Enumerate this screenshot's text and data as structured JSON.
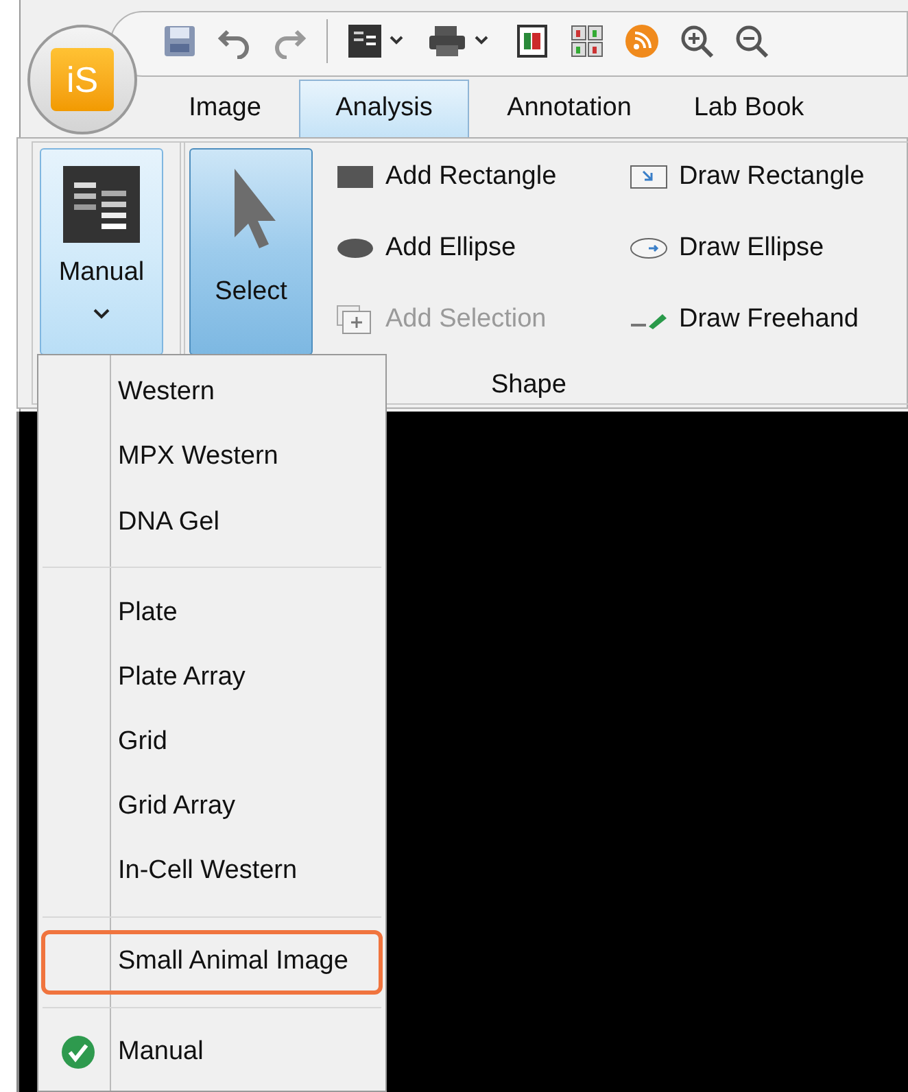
{
  "app_button": {
    "label": "iS"
  },
  "tabs": [
    {
      "label": "Image",
      "selected": false
    },
    {
      "label": "Analysis",
      "selected": true
    },
    {
      "label": "Annotation",
      "selected": false
    },
    {
      "label": "Lab Book",
      "selected": false
    }
  ],
  "ribbon": {
    "large_buttons": [
      {
        "label": "Manual",
        "expanded": true,
        "pressed": false,
        "dropdown": true
      },
      {
        "label": "Select",
        "expanded": false,
        "pressed": true,
        "dropdown": false
      }
    ],
    "shape_tools": [
      {
        "kind": "rect",
        "label": "Add Rectangle",
        "disabled": false
      },
      {
        "kind": "draw-rect",
        "label": "Draw Rectangle",
        "disabled": false
      },
      {
        "kind": "ellipse",
        "label": "Add Ellipse",
        "disabled": false
      },
      {
        "kind": "draw-ellipse",
        "label": "Draw Ellipse",
        "disabled": false
      },
      {
        "kind": "selection",
        "label": "Add Selection",
        "disabled": true
      },
      {
        "kind": "freehand",
        "label": "Draw Freehand",
        "disabled": false
      }
    ],
    "group_label": "Shape"
  },
  "menu": {
    "groups": [
      {
        "items": [
          {
            "label": "Western",
            "checked": false,
            "outlined": false
          },
          {
            "label": "MPX Western",
            "checked": false,
            "outlined": false
          },
          {
            "label": "DNA Gel",
            "checked": false,
            "outlined": false
          }
        ]
      },
      {
        "items": [
          {
            "label": "Plate",
            "checked": false,
            "outlined": false
          },
          {
            "label": "Plate Array",
            "checked": false,
            "outlined": false
          },
          {
            "label": "Grid",
            "checked": false,
            "outlined": false
          },
          {
            "label": "Grid Array",
            "checked": false,
            "outlined": false
          },
          {
            "label": "In-Cell Western",
            "checked": false,
            "outlined": false
          }
        ]
      },
      {
        "items": [
          {
            "label": "Small Animal Image",
            "checked": false,
            "outlined": true
          }
        ]
      },
      {
        "items": [
          {
            "label": "Manual",
            "checked": true,
            "outlined": false
          }
        ]
      }
    ]
  }
}
